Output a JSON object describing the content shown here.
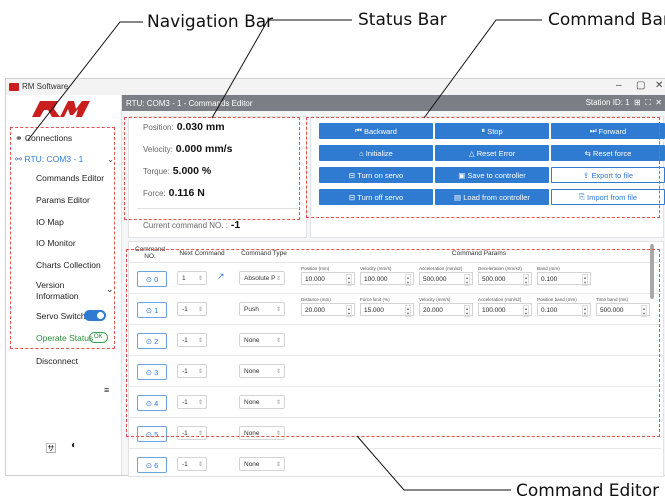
{
  "callouts": {
    "navigation_bar": "Navigation Bar",
    "status_bar": "Status Bar",
    "command_bar": "Command Bar",
    "command_editor": "Command Editor"
  },
  "window": {
    "app_title": "RM Software",
    "controls": [
      "–",
      "▢",
      "✕"
    ]
  },
  "sidebar": {
    "connections": "Connections",
    "rtu": "RTU: COM3 - 1",
    "items": [
      "Commands Editor",
      "Params Editor",
      "IO Map",
      "IO Monitor",
      "Charts Collection"
    ],
    "version": "Version Information",
    "servo_switch": "Servo Switch",
    "operate_status": "Operate Status",
    "operate_status_badge": "OK",
    "disconnect": "Disconnect"
  },
  "header": {
    "title": "RTU: COM3 - 1 - Commands Editor",
    "station": "Station ID: 1"
  },
  "status": {
    "position_label": "Position:",
    "position_value": "0.030 mm",
    "velocity_label": "Velocity:",
    "velocity_value": "0.000 mm/s",
    "torque_label": "Torque:",
    "torque_value": "5.000 %",
    "force_label": "Force:",
    "force_value": "0.116 N",
    "current_cmd_label": "Current command NO. :",
    "current_cmd_value": "-1"
  },
  "commands": {
    "backward": "Backward",
    "stop": "Stop",
    "forward": "Forward",
    "initialize": "Initialize",
    "reset_error": "Reset Error",
    "reset_force": "Reset force",
    "servo_on": "Turn on servo",
    "save_controller": "Save to controller",
    "export_file": "Export to file",
    "servo_off": "Turn off servo",
    "load_controller": "Load from controller",
    "import_file": "Import from file"
  },
  "table": {
    "headers": [
      "Command NO.",
      "Next Command",
      "Command Type",
      "Command Params"
    ],
    "rows": [
      {
        "no": "0",
        "next": "1",
        "type": "Absolute P",
        "params": [
          [
            "Position (mm)",
            "10.000"
          ],
          [
            "Velocity (mm/s)",
            "100.000"
          ],
          [
            "Acceleration (mm/s2)",
            "500.000"
          ],
          [
            "Deceleration (mm/s2)",
            "500.000"
          ],
          [
            "Band (mm)",
            "0.100"
          ]
        ]
      },
      {
        "no": "1",
        "next": "-1",
        "type": "Push",
        "params": [
          [
            "Distance (mm)",
            "20.000"
          ],
          [
            "Force limit (%)",
            "15.000"
          ],
          [
            "Velocity (mm/s)",
            "20.000"
          ],
          [
            "Acceleration (mm/s2)",
            "100.000"
          ],
          [
            "Position band (mm)",
            "0.100"
          ],
          [
            "Time band (ms)",
            "500.000"
          ]
        ]
      },
      {
        "no": "2",
        "next": "-1",
        "type": "None",
        "params": []
      },
      {
        "no": "3",
        "next": "-1",
        "type": "None",
        "params": []
      },
      {
        "no": "4",
        "next": "-1",
        "type": "None",
        "params": []
      },
      {
        "no": "5",
        "next": "-1",
        "type": "None",
        "params": []
      },
      {
        "no": "6",
        "next": "-1",
        "type": "None",
        "params": []
      }
    ]
  },
  "colors": {
    "accent": "#2f7bd1",
    "callout_box": "#e05252",
    "header": "#7b7e85",
    "ok": "#3aa64c"
  }
}
